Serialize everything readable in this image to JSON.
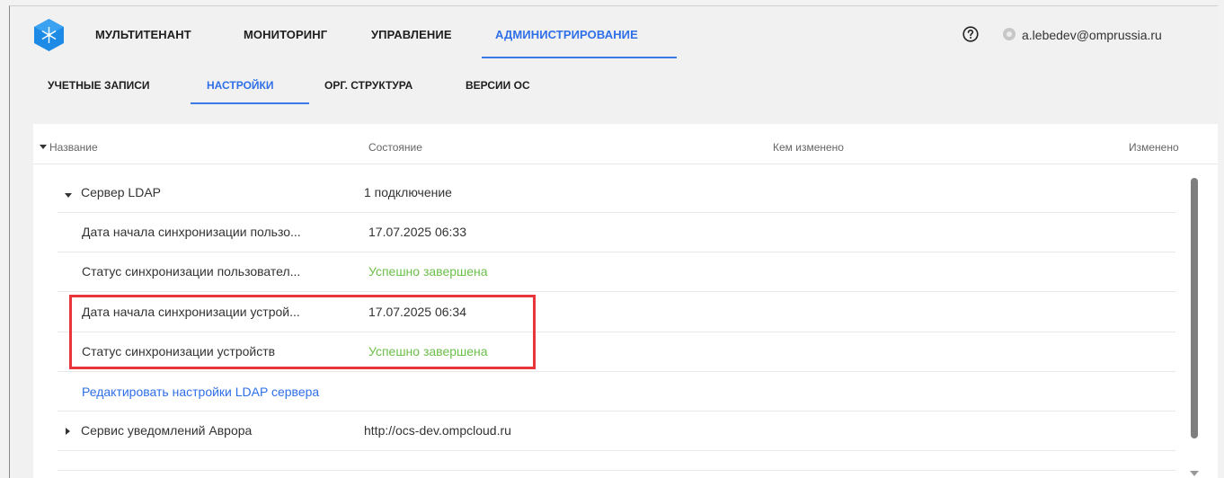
{
  "topnav": {
    "items": [
      "МУЛЬТИТЕНАНТ",
      "МОНИТОРИНГ",
      "УПРАВЛЕНИЕ",
      "АДМИНИСТРИРОВАНИЕ"
    ],
    "active_index": 3
  },
  "user": {
    "email": "a.lebedev@omprussia.ru"
  },
  "subnav": {
    "items": [
      "УЧЕТНЫЕ ЗАПИСИ",
      "НАСТРОЙКИ",
      "ОРГ. СТРУКТУРА",
      "ВЕРСИИ ОС"
    ],
    "active_index": 1
  },
  "table": {
    "columns": [
      "Название",
      "Состояние",
      "Кем изменено",
      "Изменено"
    ],
    "ldap_group": {
      "name": "Сервер LDAP",
      "state": "1 подключение",
      "expanded": true
    },
    "rows": [
      {
        "name": "Дата начала синхронизации пользо...",
        "state": "17.07.2025 06:33",
        "state_status": "normal"
      },
      {
        "name": "Статус синхронизации пользовател...",
        "state": "Успешно завершена",
        "state_status": "success"
      },
      {
        "name": "Дата начала синхронизации устрой...",
        "state": "17.07.2025 06:34",
        "state_status": "normal"
      },
      {
        "name": "Статус синхронизации устройств",
        "state": "Успешно завершена",
        "state_status": "success"
      }
    ],
    "edit_link": "Редактировать настройки LDAP сервера",
    "push_group": {
      "name": "Сервис уведомлений Аврора",
      "state": "http://ocs-dev.ompcloud.ru",
      "expanded": false
    }
  },
  "colors": {
    "accent": "#2f6fe8",
    "success": "#6cbf4a",
    "highlight_border": "#e8343b"
  },
  "icons": [
    "app-logo-icon",
    "help-icon",
    "user-avatar-icon",
    "sort-caret-icon",
    "expand-caret-icon",
    "collapse-caret-icon"
  ]
}
